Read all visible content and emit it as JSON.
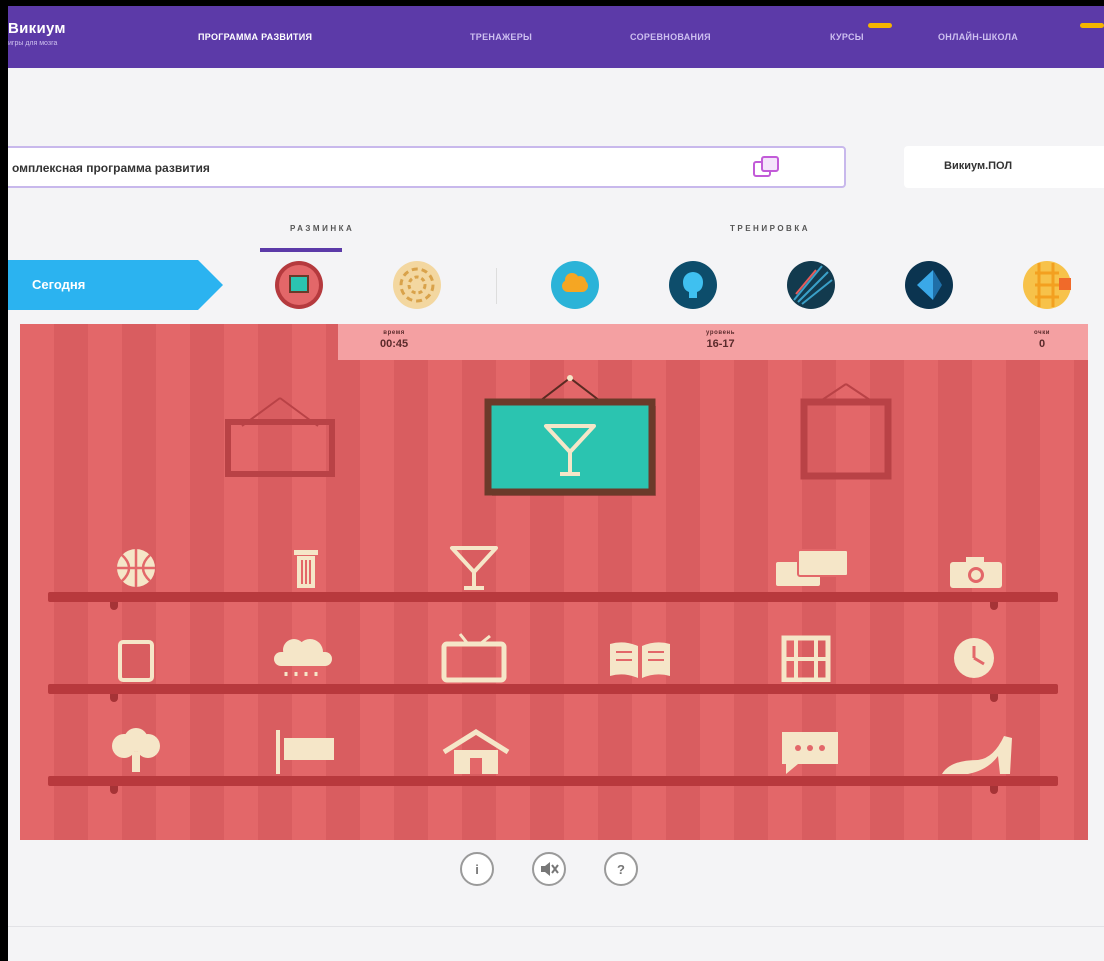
{
  "nav": {
    "brand": "Викиум",
    "brand_tagline": "игры для мозга",
    "links": [
      "ПРОГРАММА РАЗВИТИЯ",
      "ТРЕНАЖЕРЫ",
      "СОРЕВНОВАНИЯ",
      "КУРСЫ",
      "ОНЛАЙН-ШКОЛА"
    ],
    "accent_color": "#5c3aa8",
    "badge_color": "#f5b400"
  },
  "program": {
    "selected": "омплексная программа развития",
    "right_selected": "Викиум.ПОЛ"
  },
  "tabs": [
    "РАЗМИНКА",
    "ТРЕНИРОВКА"
  ],
  "today": {
    "label": "Сегодня",
    "games": [
      "frame-game-icon",
      "spiral-game-icon",
      "cloud-game-icon",
      "head-game-icon",
      "lines-game-icon",
      "diamond-game-icon",
      "grid-game-icon"
    ]
  },
  "hud": {
    "time_label": "время",
    "time_value": "00:45",
    "level_label": "уровень",
    "level_value": "16-17",
    "score_label": "очки",
    "score_value": "0"
  },
  "game": {
    "target_icon": "cocktail-glass-icon",
    "shelves": [
      [
        "basketball-icon",
        "trash-can-icon",
        "cocktail-glass-icon",
        "",
        "chat-bubbles-icon",
        "camera-icon"
      ],
      [
        "tablet-icon",
        "rain-cloud-icon",
        "tv-icon",
        "open-book-icon",
        "film-strip-icon",
        "clock-icon"
      ],
      [
        "tree-icon",
        "flag-icon",
        "house-icon",
        "",
        "speech-bubble-icon",
        "high-heel-icon"
      ]
    ]
  },
  "controls": {
    "info": "i",
    "sound": "🔇",
    "help": "?"
  }
}
